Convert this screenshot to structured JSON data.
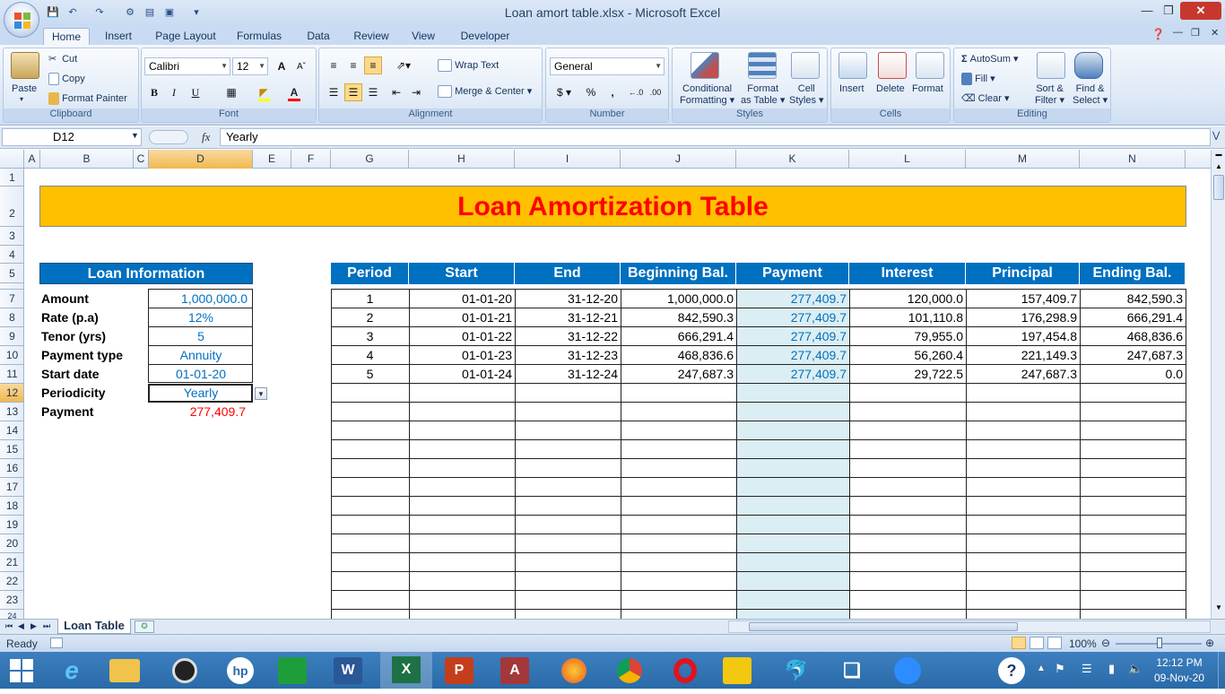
{
  "window": {
    "title": "Loan amort table.xlsx - Microsoft Excel"
  },
  "ribbon_tabs": [
    "Home",
    "Insert",
    "Page Layout",
    "Formulas",
    "Data",
    "Review",
    "View",
    "Developer"
  ],
  "clipboard": {
    "paste": "Paste",
    "cut": "Cut",
    "copy": "Copy",
    "format_painter": "Format Painter",
    "label": "Clipboard"
  },
  "font": {
    "name": "Calibri",
    "size": "12",
    "bold": "B",
    "italic": "I",
    "underline": "U",
    "grow": "A",
    "label": "Font"
  },
  "alignment": {
    "wrap": "Wrap Text",
    "merge": "Merge & Center",
    "label": "Alignment"
  },
  "number": {
    "format": "General",
    "currency": "$",
    "percent": "%",
    "comma": ",",
    "label": "Number"
  },
  "styles": {
    "conditional": "Conditional",
    "conditional2": "Formatting",
    "format_table": "Format",
    "format_table2": "as Table",
    "cell_styles": "Cell",
    "cell_styles2": "Styles",
    "label": "Styles"
  },
  "cells_group": {
    "insert": "Insert",
    "delete": "Delete",
    "format": "Format",
    "label": "Cells"
  },
  "editing": {
    "autosum": "AutoSum",
    "fill": "Fill",
    "clear": "Clear",
    "sort": "Sort &",
    "sort2": "Filter",
    "find": "Find &",
    "find2": "Select",
    "label": "Editing"
  },
  "formula_bar": {
    "name_box": "D12",
    "fx": "fx",
    "value": "Yearly"
  },
  "columns": [
    "A",
    "B",
    "C",
    "D",
    "E",
    "F",
    "G",
    "H",
    "I",
    "J",
    "K",
    "L",
    "M",
    "N"
  ],
  "rows": [
    "1",
    "2",
    "3",
    "4",
    "5",
    "7",
    "8",
    "9",
    "10",
    "11",
    "12",
    "13",
    "14",
    "15",
    "16",
    "17",
    "18",
    "19",
    "20",
    "21",
    "22",
    "23",
    "24"
  ],
  "banner": "Loan Amortization Table",
  "loan_info": {
    "header": "Loan Information",
    "labels": [
      "Amount",
      "Rate (p.a)",
      "Tenor (yrs)",
      "Payment type",
      "Start date",
      "Periodicity",
      "Payment"
    ],
    "values": [
      "1,000,000.0",
      "12%",
      "5",
      "Annuity",
      "01-01-20",
      "Yearly",
      "277,409.7"
    ]
  },
  "table": {
    "headers": [
      "Period",
      "Start",
      "End",
      "Beginning Bal.",
      "Payment",
      "Interest",
      "Principal",
      "Ending Bal."
    ],
    "rows": [
      [
        "1",
        "01-01-20",
        "31-12-20",
        "1,000,000.0",
        "277,409.7",
        "120,000.0",
        "157,409.7",
        "842,590.3"
      ],
      [
        "2",
        "01-01-21",
        "31-12-21",
        "842,590.3",
        "277,409.7",
        "101,110.8",
        "176,298.9",
        "666,291.4"
      ],
      [
        "3",
        "01-01-22",
        "31-12-22",
        "666,291.4",
        "277,409.7",
        "79,955.0",
        "197,454.8",
        "468,836.6"
      ],
      [
        "4",
        "01-01-23",
        "31-12-23",
        "468,836.6",
        "277,409.7",
        "56,260.4",
        "221,149.3",
        "247,687.3"
      ],
      [
        "5",
        "01-01-24",
        "31-12-24",
        "247,687.3",
        "277,409.7",
        "29,722.5",
        "247,687.3",
        "0.0"
      ]
    ]
  },
  "sheet_tab": "Loan Table",
  "status": {
    "ready": "Ready",
    "zoom": "100%"
  },
  "clock": {
    "time": "12:12 PM",
    "date": "09-Nov-20"
  },
  "colors": {
    "banner_bg": "#ffc000",
    "banner_text": "#ff0000",
    "header_bg": "#0070c0",
    "payment_col_bg": "#dbeef3",
    "value_blue": "#0070c0",
    "payment_red": "#ff0000"
  }
}
